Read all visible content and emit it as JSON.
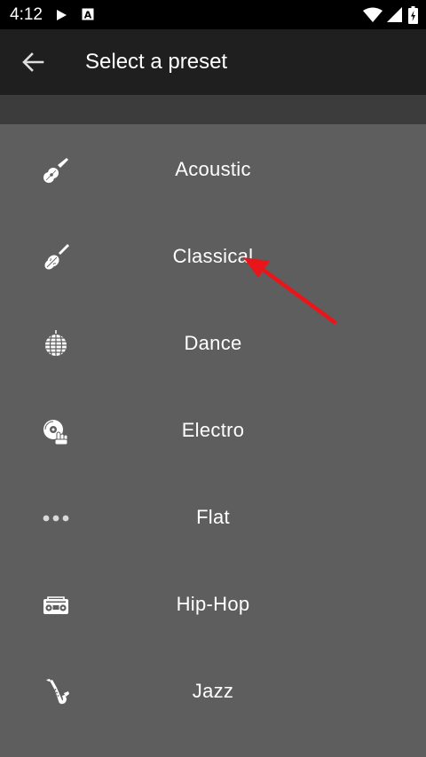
{
  "status": {
    "time": "4:12"
  },
  "app_bar": {
    "title": "Select a preset"
  },
  "presets": [
    {
      "label": "Acoustic",
      "icon": "guitar-icon"
    },
    {
      "label": "Classical",
      "icon": "violin-icon"
    },
    {
      "label": "Dance",
      "icon": "disco-ball-icon"
    },
    {
      "label": "Electro",
      "icon": "turntable-icon"
    },
    {
      "label": "Flat",
      "icon": "dots-icon"
    },
    {
      "label": "Hip-Hop",
      "icon": "boombox-icon"
    },
    {
      "label": "Jazz",
      "icon": "saxophone-icon"
    }
  ],
  "colors": {
    "background": "#5e5e5f",
    "app_bar": "#1f1f1f",
    "annotation_arrow": "#e8151b"
  }
}
